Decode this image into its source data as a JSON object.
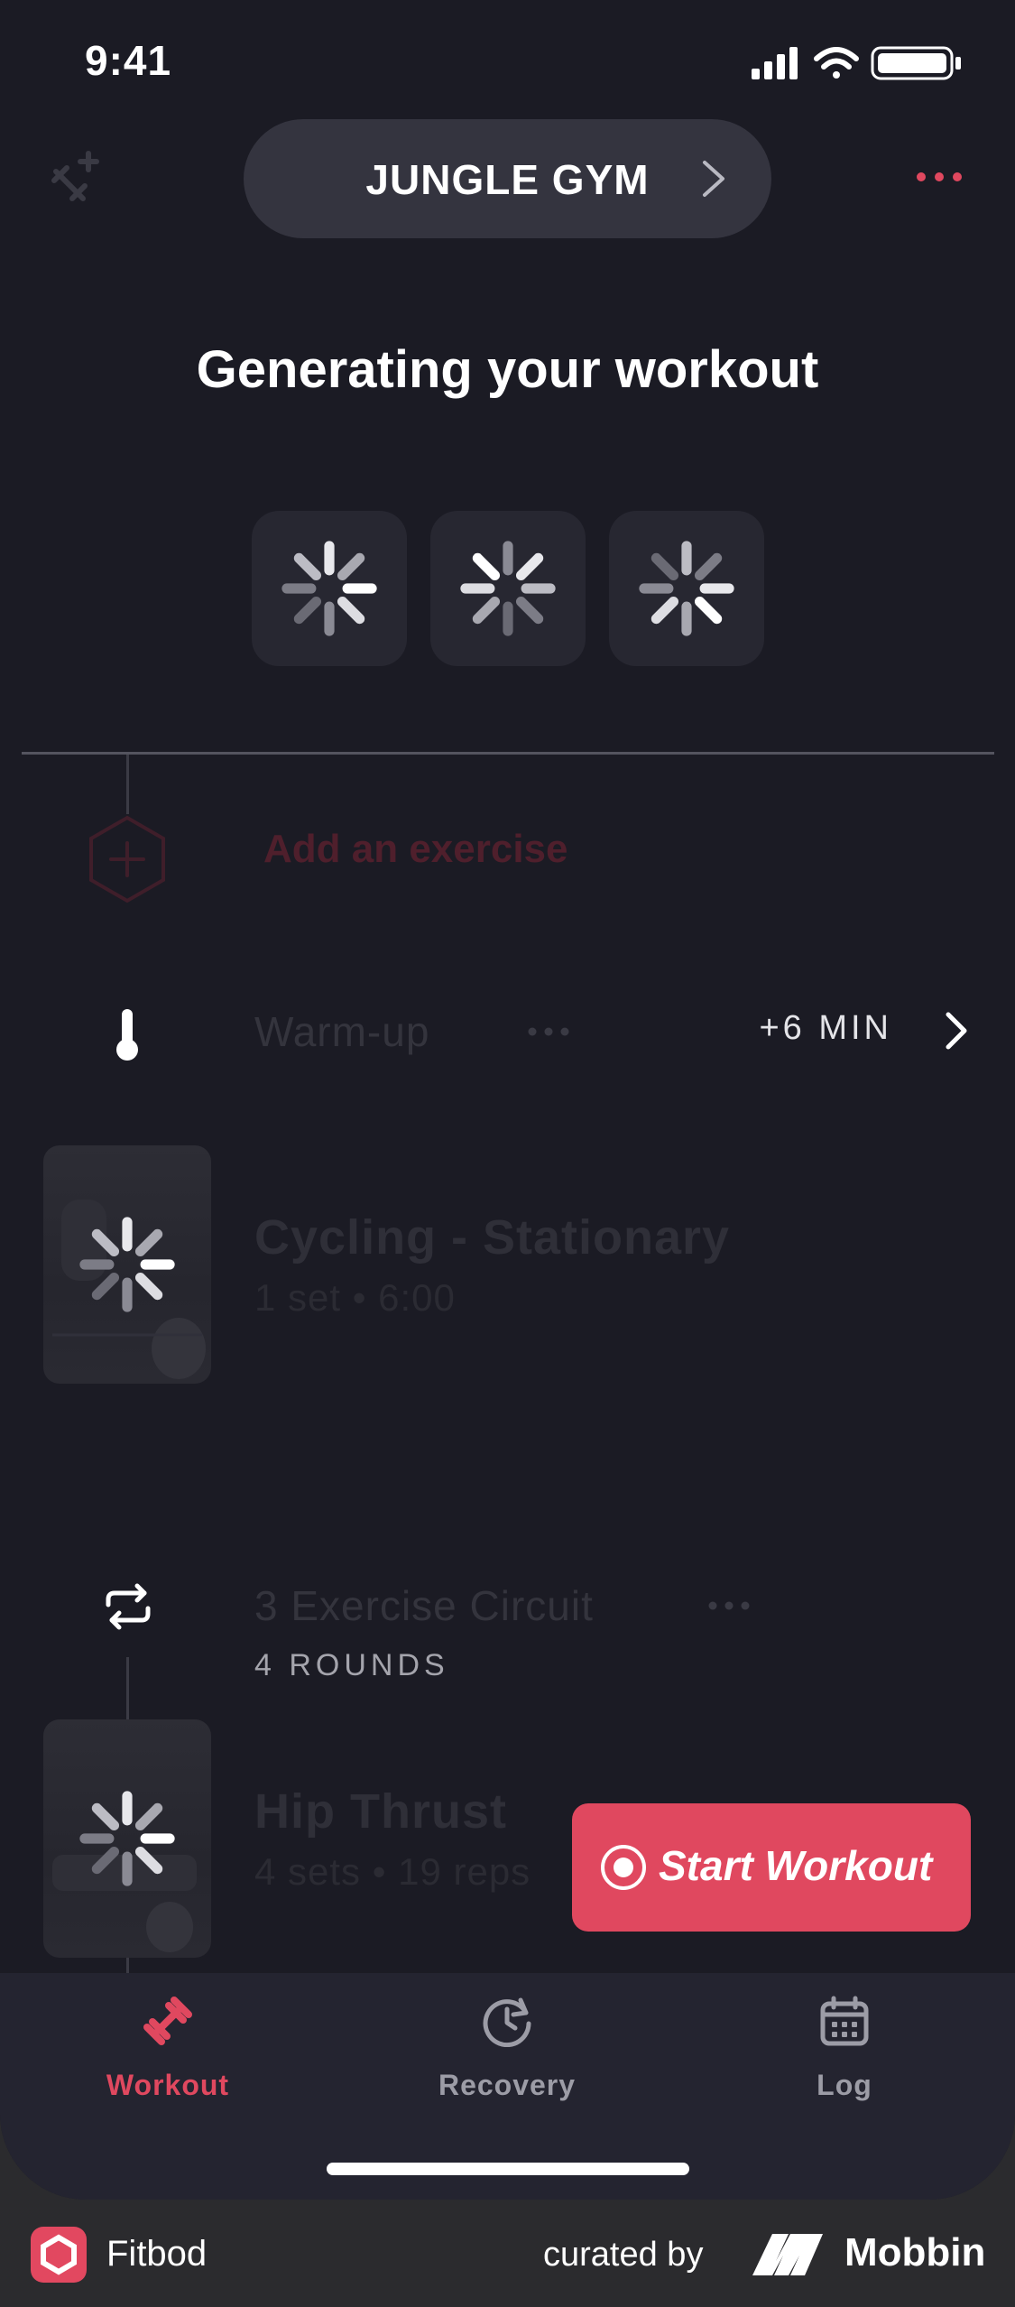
{
  "status_bar": {
    "time": "9:41"
  },
  "header": {
    "gym_name": "JUNGLE GYM"
  },
  "generating": {
    "title": "Generating your workout"
  },
  "add_exercise": {
    "label": "Add an exercise"
  },
  "warmup": {
    "label": "Warm-up",
    "duration": "+6 MIN"
  },
  "exercises": [
    {
      "name": "Cycling - Stationary",
      "detail": "1 set • 6:00"
    },
    {
      "name": "Hip Thrust",
      "detail": "4 sets • 19 reps"
    }
  ],
  "circuit": {
    "label": "3 Exercise Circuit",
    "rounds": "4 ROUNDS"
  },
  "start_button": {
    "label": "Start Workout"
  },
  "tabs": [
    {
      "label": "Workout",
      "active": true
    },
    {
      "label": "Recovery",
      "active": false
    },
    {
      "label": "Log",
      "active": false
    }
  ],
  "footer": {
    "app_name": "Fitbod",
    "curated_by": "curated by",
    "brand": "Mobbin"
  },
  "colors": {
    "accent": "#e0485f",
    "background": "#1b1b24",
    "tab_bar": "#242430",
    "pill": "#34343f"
  }
}
